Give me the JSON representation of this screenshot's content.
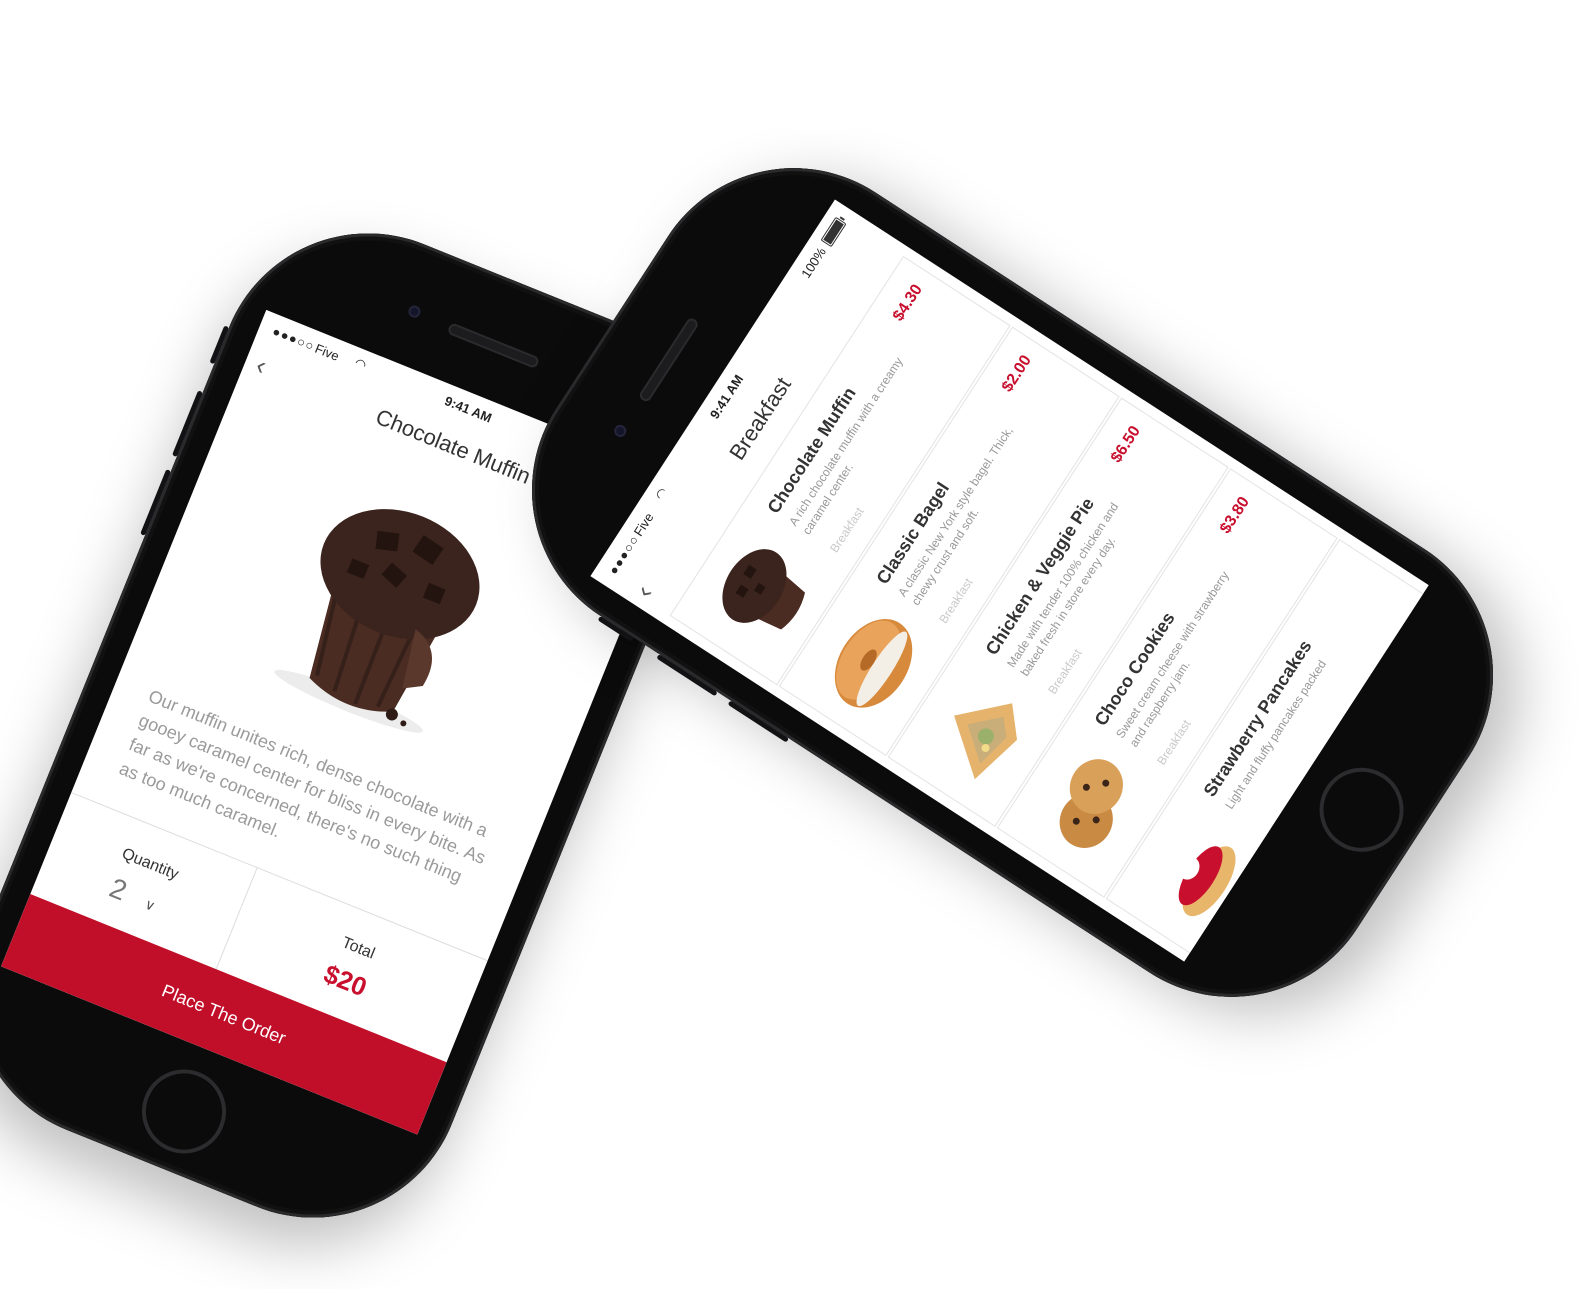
{
  "colors": {
    "accent": "#c10f2a",
    "text": "#333333",
    "muted": "#9a9a9a",
    "placeholder": "#c9c9c9"
  },
  "status_bar": {
    "carrier": "Five",
    "time": "9:41 AM",
    "battery": "100%",
    "signal": "●●●○○"
  },
  "detail": {
    "back_icon": "chevron-left-icon",
    "title": "Chocolate Muffin",
    "favorite_icon": "heart-icon",
    "description": "Our muffin unites rich, dense chocolate with a gooey caramel center for bliss in every bite. As far as we're concerned, there's no such thing as too much caramel.",
    "quantity_label": "Quantity",
    "quantity_value": "2",
    "total_label": "Total",
    "total_value": "$20",
    "order_button": "Place The Order"
  },
  "menu": {
    "back_icon": "chevron-left-icon",
    "title": "Breakfast",
    "items": [
      {
        "name": "Chocolate Muffin",
        "desc": "A rich chocolate muffin with a creamy caramel center.",
        "category": "Breakfast",
        "price": "$4.30",
        "image": "muffin"
      },
      {
        "name": "Classic Bagel",
        "desc": "A classic New York style bagel. Thick, chewy crust and soft.",
        "category": "Breakfast",
        "price": "$2.00",
        "image": "bagel"
      },
      {
        "name": "Chicken & Veggie Pie",
        "desc": "Made with tender 100% chicken and baked fresh in store every day.",
        "category": "Breakfast",
        "price": "$6.50",
        "image": "pie"
      },
      {
        "name": "Choco Cookies",
        "desc": "Sweet cream cheese with strawberry and raspberry jam.",
        "category": "Breakfast",
        "price": "$3.80",
        "image": "cookies"
      },
      {
        "name": "Strawberry Pancakes",
        "desc": "Light and fluffy pancakes packed",
        "category": "",
        "price": "",
        "image": "pancakes"
      }
    ]
  }
}
